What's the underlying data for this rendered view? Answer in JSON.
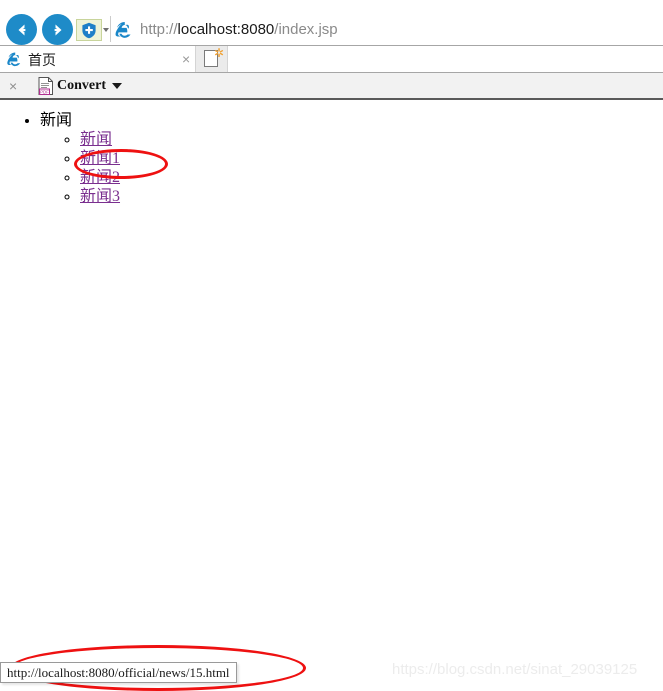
{
  "browser": {
    "navigation": {
      "back_label": "Back",
      "forward_label": "Forward",
      "back_icon": "arrow-left-icon",
      "forward_icon": "arrow-right-icon"
    },
    "tracking_protection": {
      "icon": "shield-plus-icon",
      "dropdown_icon": "chevron-down-icon",
      "background_color": "#eef3d8",
      "shield_color": "#1e7fc8"
    },
    "address_bar": {
      "site_icon": "ie-logo-icon",
      "url_prefix": "http://",
      "url_domain": "localhost:8080",
      "url_path": "/index.jsp",
      "full_url": "http://localhost:8080/index.jsp",
      "placeholder": "http://localhost:8080/index.jsp"
    },
    "tabs": [
      {
        "icon": "ie-logo-icon",
        "title": "首页",
        "close_icon": "close-icon",
        "close_label": "×",
        "active": true
      }
    ],
    "new_tab": {
      "icon": "new-tab-icon",
      "star_glyph": "✲",
      "label": "New tab"
    },
    "addon_toolbar": {
      "close_icon": "close-icon",
      "close_label": "×",
      "pdf_icon": "pdf-document-icon",
      "pdf_badge": "PDF",
      "convert_label": "Convert",
      "dropdown_icon": "chevron-down-icon"
    }
  },
  "page": {
    "list": {
      "top_item": "新闻",
      "sub_items": [
        {
          "label": "新闻"
        },
        {
          "label": "新闻1"
        },
        {
          "label": "新闻2"
        },
        {
          "label": "新闻3"
        }
      ],
      "link_color": "#7a2f8f"
    }
  },
  "status_bar": {
    "text": "http://localhost:8080/official/news/15.html"
  },
  "annotations": {
    "color": "#ee1111",
    "link_ellipse_label": "red-ellipse-around-news1",
    "status_ellipse_label": "red-ellipse-around-status-url"
  },
  "watermark": {
    "text": "https://blog.csdn.net/sinat_29039125"
  }
}
